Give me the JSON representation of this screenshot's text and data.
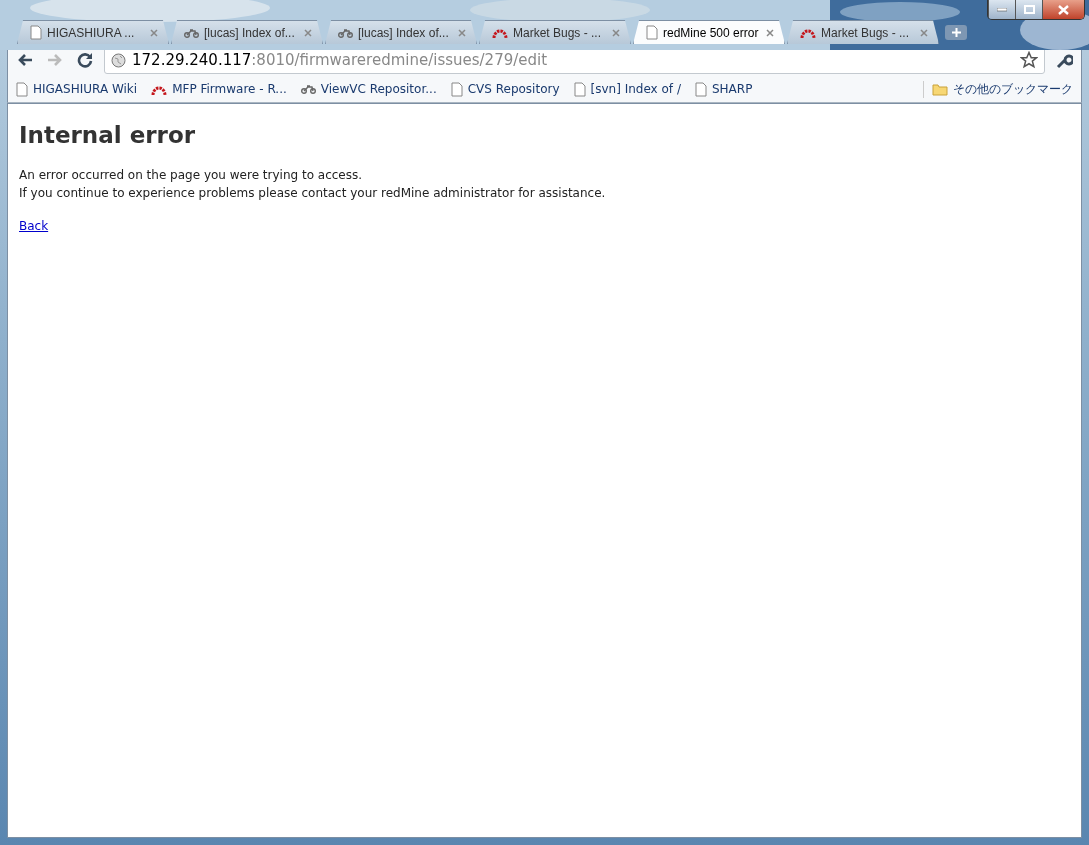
{
  "tabs": [
    {
      "title": "HIGASHIURA ...",
      "kind": "page",
      "selected": false
    },
    {
      "title": "[lucas] Index of...",
      "kind": "bike",
      "selected": false
    },
    {
      "title": "[lucas] Index of...",
      "kind": "bike",
      "selected": false
    },
    {
      "title": "Market Bugs - ...",
      "kind": "arch",
      "selected": false
    },
    {
      "title": "redMine 500 error",
      "kind": "page",
      "selected": true
    },
    {
      "title": "Market Bugs - ...",
      "kind": "arch",
      "selected": false
    }
  ],
  "toolbar": {
    "back_disabled": false,
    "forward_disabled": true,
    "url": {
      "host": "172.29.240.117",
      "rest": ":8010/firmwareredmine/issues/279/edit"
    }
  },
  "bookmarks": [
    {
      "title": "HIGASHIURA Wiki",
      "kind": "page"
    },
    {
      "title": "MFP Firmware - R...",
      "kind": "arch"
    },
    {
      "title": "ViewVC Repositor...",
      "kind": "bike"
    },
    {
      "title": "CVS Repository",
      "kind": "page"
    },
    {
      "title": "[svn] Index of /",
      "kind": "page"
    },
    {
      "title": "SHARP",
      "kind": "page"
    }
  ],
  "other_bookmarks": {
    "title": "その他のブックマーク"
  },
  "page": {
    "heading": "Internal error",
    "paragraph_lines": [
      "An error occurred on the page you were trying to access.",
      "If you continue to experience problems please contact your redMine administrator for assistance."
    ],
    "link": "Back"
  }
}
